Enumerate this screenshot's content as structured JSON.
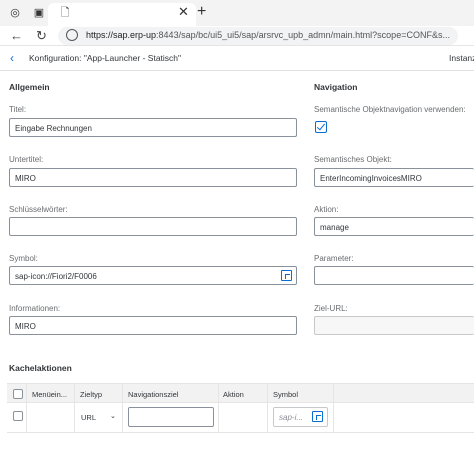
{
  "browser": {
    "url_host": "https://sap.erp-up",
    "url_rest": ":8443/sap/bc/ui5_ui5/sap/arsrvc_upb_admn/main.html?scope=CONF&s...",
    "close_label": "✕",
    "new_tab_label": "+",
    "back_label": "←",
    "reload_label": "↻"
  },
  "header": {
    "back_label": "‹",
    "title": "Konfiguration: \"App-Launcher - Statisch\"",
    "right_text": "Instanz"
  },
  "allgemein": {
    "section_title": "Allgemein",
    "titel_label": "Titel:",
    "titel_value": "Eingabe Rechnungen",
    "untertitel_label": "Untertitel:",
    "untertitel_value": "MIRO",
    "schluesselwoerter_label": "Schlüsselwörter:",
    "schluesselwoerter_value": "",
    "symbol_label": "Symbol:",
    "symbol_value": "sap-icon://Fiori2/F0006",
    "informationen_label": "Informationen:",
    "informationen_value": "MIRO"
  },
  "navigation": {
    "section_title": "Navigation",
    "semnav_label": "Semantische Objektnavigation verwenden:",
    "semnav_checked": true,
    "semobj_label": "Semantisches Objekt:",
    "semobj_value": "EnterIncomingInvoicesMIRO",
    "aktion_label": "Aktion:",
    "aktion_value": "manage",
    "parameter_label": "Parameter:",
    "parameter_value": "",
    "zielurl_label": "Ziel-URL:",
    "zielurl_value": ""
  },
  "kachelaktionen": {
    "section_title": "Kachelaktionen",
    "columns": [
      "Menüein...",
      "Zieltyp",
      "Navigationsziel",
      "Aktion",
      "Symbol"
    ],
    "row": {
      "zieltyp": "URL",
      "navigationsziel": "",
      "aktion": "",
      "symbol_placeholder": "sap-i..."
    }
  }
}
